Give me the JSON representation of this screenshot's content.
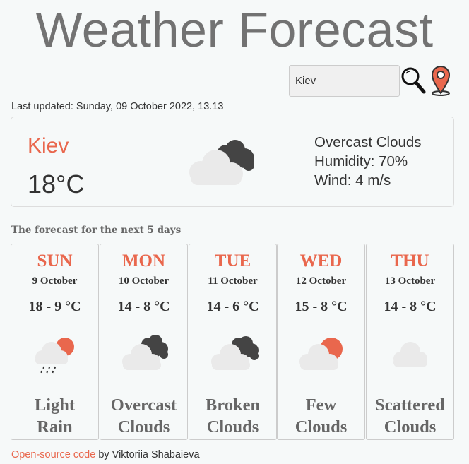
{
  "header": {
    "title": "Weather Forecast"
  },
  "search": {
    "value": "Kiev",
    "search_icon": "magnifier-icon",
    "location_icon": "location-pin-icon"
  },
  "last_updated": "Last updated: Sunday, 09 October 2022, 13.13",
  "current": {
    "city": "Kiev",
    "temperature": "18°C",
    "icon": "overcast-clouds-icon",
    "description": "Overcast Clouds",
    "humidity": "Humidity: 70%",
    "wind": "Wind: 4 m/s"
  },
  "forecast": {
    "heading": "The forecast for the next 5 days",
    "days": [
      {
        "day": "SUN",
        "date": "9 October",
        "temps": "18 - 9 °C",
        "icon": "light-rain-icon",
        "desc1": "Light",
        "desc2": "Rain"
      },
      {
        "day": "MON",
        "date": "10 October",
        "temps": "14 - 8 °C",
        "icon": "overcast-clouds-icon",
        "desc1": "Overcast",
        "desc2": "Clouds"
      },
      {
        "day": "TUE",
        "date": "11 October",
        "temps": "14 - 6 °C",
        "icon": "broken-clouds-icon",
        "desc1": "Broken",
        "desc2": "Clouds"
      },
      {
        "day": "WED",
        "date": "12 October",
        "temps": "15 - 8 °C",
        "icon": "few-clouds-icon",
        "desc1": "Few",
        "desc2": "Clouds"
      },
      {
        "day": "THU",
        "date": "13 October",
        "temps": "14 - 8 °C",
        "icon": "scattered-clouds-icon",
        "desc1": "Scattered",
        "desc2": "Clouds"
      }
    ]
  },
  "footer": {
    "link_text": "Open-source code",
    "rest": " by Viktoriia Shabaieva"
  },
  "colors": {
    "accent": "#e9674d",
    "title": "#727272",
    "cloud_light": "#eaeaea",
    "cloud_dark": "#444444"
  }
}
